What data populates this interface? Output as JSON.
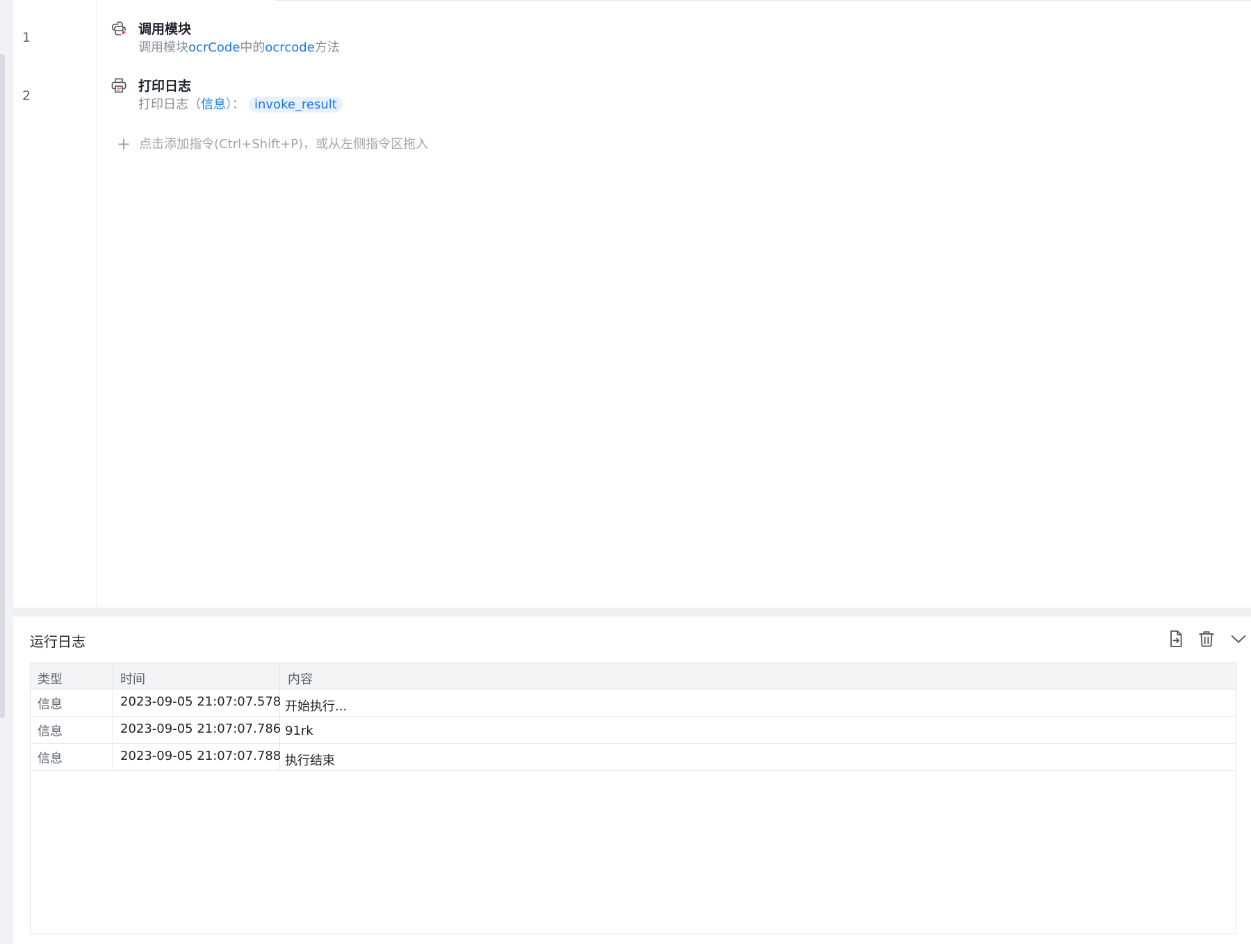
{
  "editor": {
    "lines": [
      {
        "num": "1",
        "icon": "python-module-icon",
        "title": "调用模块",
        "desc_prefix": "调用模块",
        "module": "ocrCode",
        "desc_mid": "中的",
        "method": "ocrcode",
        "desc_suffix": "方法"
      },
      {
        "num": "2",
        "icon": "printer-icon",
        "title": "打印日志",
        "desc_prefix": "打印日志（",
        "level": "信息",
        "desc_mid": "）：",
        "variable": "invoke_result"
      }
    ],
    "add_hint": "点击添加指令(Ctrl+Shift+P)，或从左侧指令区拖入"
  },
  "log_panel": {
    "title": "运行日志",
    "tools": [
      "export-icon",
      "trash-icon",
      "chevron-down-icon"
    ],
    "columns": [
      "类型",
      "时间",
      "内容"
    ],
    "rows": [
      {
        "type": "信息",
        "time": "2023-09-05 21:07:07.578",
        "content": "开始执行..."
      },
      {
        "type": "信息",
        "time": "2023-09-05 21:07:07.786",
        "content": "91rk"
      },
      {
        "type": "信息",
        "time": "2023-09-05 21:07:07.788",
        "content": "执行结束"
      }
    ]
  },
  "colors": {
    "accent": "#1677e5",
    "chip_bg": "#e6f1fd",
    "muted_text": "#8a9099",
    "header_bg": "#f3f4f6"
  }
}
